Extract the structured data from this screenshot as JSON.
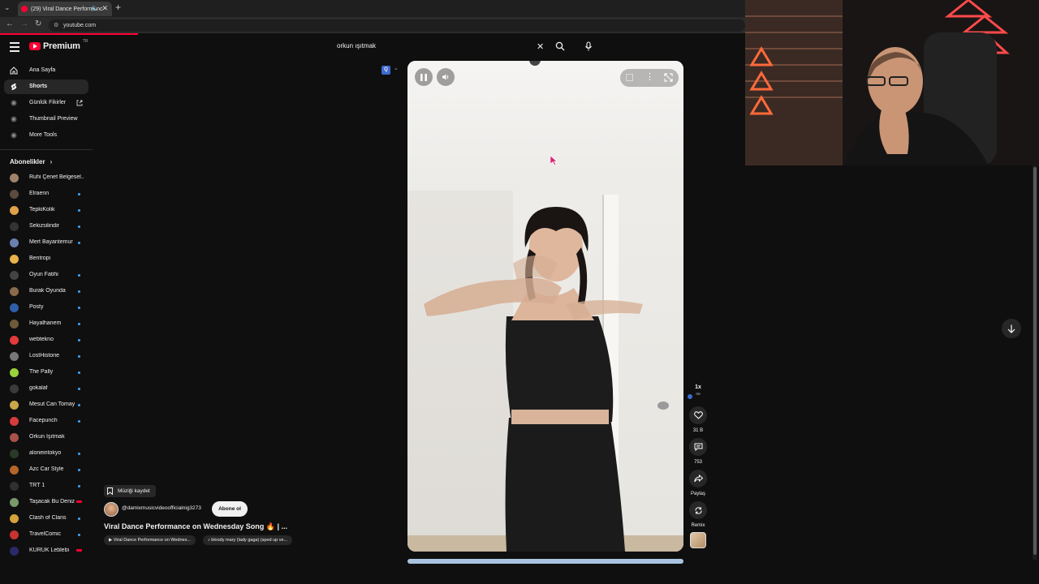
{
  "browser": {
    "tab_title": "(29) Viral Dance Performanc",
    "url": "youtube.com"
  },
  "masthead": {
    "logo_text": "Premium",
    "logo_country": "TR",
    "search_value": "orkun ışıtmak"
  },
  "sidebar": {
    "items": [
      {
        "label": "Ana Sayfa",
        "icon": "home-icon"
      },
      {
        "label": "Shorts",
        "icon": "shorts-icon",
        "active": true
      },
      {
        "label": "Günlük Fikirler",
        "icon": "ext-icon"
      },
      {
        "label": "Thumbnail Preview",
        "icon": "ext-icon"
      },
      {
        "label": "More Tools",
        "icon": "ext-icon"
      }
    ],
    "subscriptions_title": "Abonelikler",
    "subscriptions": [
      {
        "name": "Ruhi Çenet Belgesel...",
        "color": "#a0826a",
        "badge": "none"
      },
      {
        "name": "Elraenn",
        "color": "#5c4b3d",
        "badge": "dot"
      },
      {
        "name": "TepkiKolik",
        "color": "#e0a24a",
        "badge": "dot"
      },
      {
        "name": "Sekizsilindir",
        "color": "#333333",
        "badge": "dot"
      },
      {
        "name": "Mert Bayantemur",
        "color": "#6a7fb0",
        "badge": "dot"
      },
      {
        "name": "Bentropi",
        "color": "#e8b34a",
        "badge": "none"
      },
      {
        "name": "Oyun Fatihi",
        "color": "#444444",
        "badge": "dot"
      },
      {
        "name": "Burak Oyunda",
        "color": "#8a6a4a",
        "badge": "dot"
      },
      {
        "name": "Posty",
        "color": "#2f5fa8",
        "badge": "dot"
      },
      {
        "name": "Hayalhanem",
        "color": "#6d5a3a",
        "badge": "dot"
      },
      {
        "name": "webtekno",
        "color": "#e23b3b",
        "badge": "dot"
      },
      {
        "name": "LostHistorie",
        "color": "#777777",
        "badge": "dot"
      },
      {
        "name": "The Pally",
        "color": "#9bd13b",
        "badge": "dot"
      },
      {
        "name": "gokalaf",
        "color": "#3a3a3a",
        "badge": "dot"
      },
      {
        "name": "Mesut Can Tomay",
        "color": "#c8a64a",
        "badge": "dot"
      },
      {
        "name": "Facepunch",
        "color": "#d63c3c",
        "badge": "dot"
      },
      {
        "name": "Orkun Işıtmak",
        "color": "#a8524a",
        "badge": "none"
      },
      {
        "name": "aloneintokyo",
        "color": "#2a3a2a",
        "badge": "dot"
      },
      {
        "name": "Azc Car Style",
        "color": "#b5652a",
        "badge": "dot"
      },
      {
        "name": "TRT 1",
        "color": "#303030",
        "badge": "dot"
      },
      {
        "name": "Taşacak Bu Deniz",
        "color": "#7a9a6a",
        "badge": "live"
      },
      {
        "name": "Clash of Clans",
        "color": "#d4a23a",
        "badge": "dot"
      },
      {
        "name": "TravelComic",
        "color": "#c9332f",
        "badge": "dot"
      },
      {
        "name": "KURUK Leblebi",
        "color": "#2a2a6a",
        "badge": "live"
      }
    ]
  },
  "short": {
    "save_music_label": "Müziği kaydet",
    "channel": "@damixmusicvideoofficialnig3273",
    "subscribe_label": "Abone ol",
    "title": "Viral Dance Performance on Wednesday Song 🔥 | ...",
    "pills": [
      "▶ Viral Dance Performance on Wednes...",
      "♪ bloody mary (lady gaga) (sped up ve..."
    ],
    "speed_label": "1x",
    "speed_sub": "SR",
    "likes": "31 B",
    "comments": "753",
    "share_label": "Paylaş",
    "remix_label": "Remix",
    "extension_badge": "Q"
  },
  "colors": {
    "accent": "#ff0033",
    "background": "#0f0f0f",
    "chip": "#272727"
  }
}
